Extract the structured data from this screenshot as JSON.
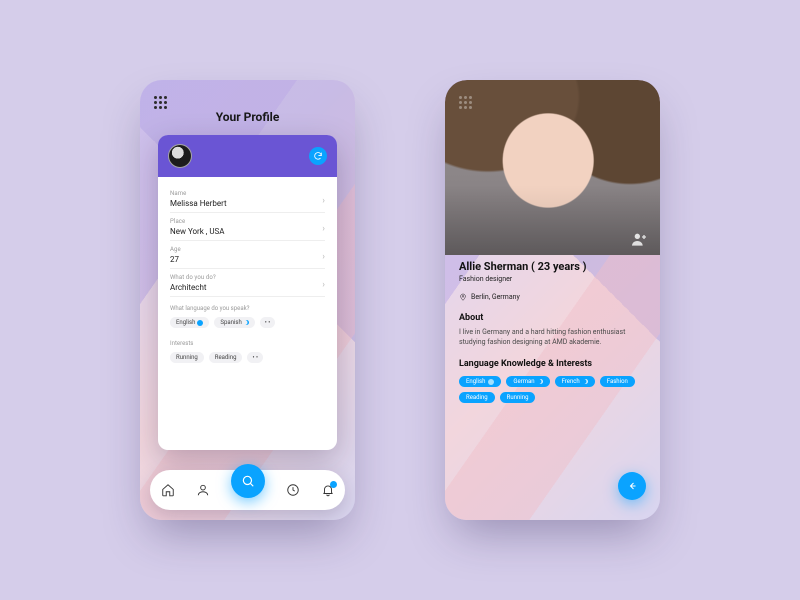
{
  "colors": {
    "accent": "#0aa3ff",
    "primary": "#6a55d4",
    "bg": "#d5cdea"
  },
  "left": {
    "title": "Your Profile",
    "fields": {
      "name": {
        "label": "Name",
        "value": "Melissa Herbert"
      },
      "place": {
        "label": "Place",
        "value": "New York , USA"
      },
      "age": {
        "label": "Age",
        "value": "27"
      },
      "job": {
        "label": "What do you do?",
        "value": "Architecht"
      }
    },
    "lang_header": "What language do you speak?",
    "languages": [
      "English",
      "Spanish"
    ],
    "interests_header": "Interests",
    "interests": [
      "Running",
      "Reading"
    ],
    "more": "• •"
  },
  "right": {
    "name": "Allie Sherman ( 23 years )",
    "role": "Fashion designer",
    "location": "Berlin, Germany",
    "about_h": "About",
    "about": "I live in Germany and a hard hitting fashion enthusiast studying fashion designing at AMD akademie.",
    "lang_h": "Language Knowledge & Interests",
    "tags": [
      "English",
      "German",
      "French",
      "Fashion",
      "Reading",
      "Running"
    ]
  }
}
